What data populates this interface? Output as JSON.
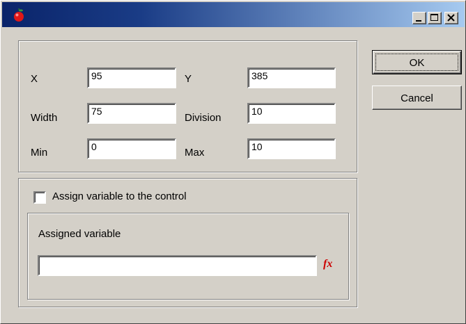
{
  "window": {
    "title": ""
  },
  "title_buttons": {
    "minimize_icon": "minimize-icon",
    "maximize_icon": "maximize-icon",
    "close_icon": "close-icon"
  },
  "fields": {
    "x": {
      "label": "X",
      "value": "95"
    },
    "y": {
      "label": "Y",
      "value": "385"
    },
    "width": {
      "label": "Width",
      "value": "75"
    },
    "division": {
      "label": "Division",
      "value": "10"
    },
    "min": {
      "label": "Min",
      "value": "0"
    },
    "max": {
      "label": "Max",
      "value": "10"
    }
  },
  "buttons": {
    "ok": "OK",
    "cancel": "Cancel"
  },
  "assign": {
    "checkbox_label": "Assign variable to the control",
    "checked": false,
    "group_label": "Assigned variable",
    "variable_value": "",
    "fx_icon": "fx",
    "fx_color": "#cc0000"
  },
  "colors": {
    "titlebar_start": "#0a246a",
    "titlebar_end": "#a6caf0",
    "face": "#d4d0c8"
  }
}
